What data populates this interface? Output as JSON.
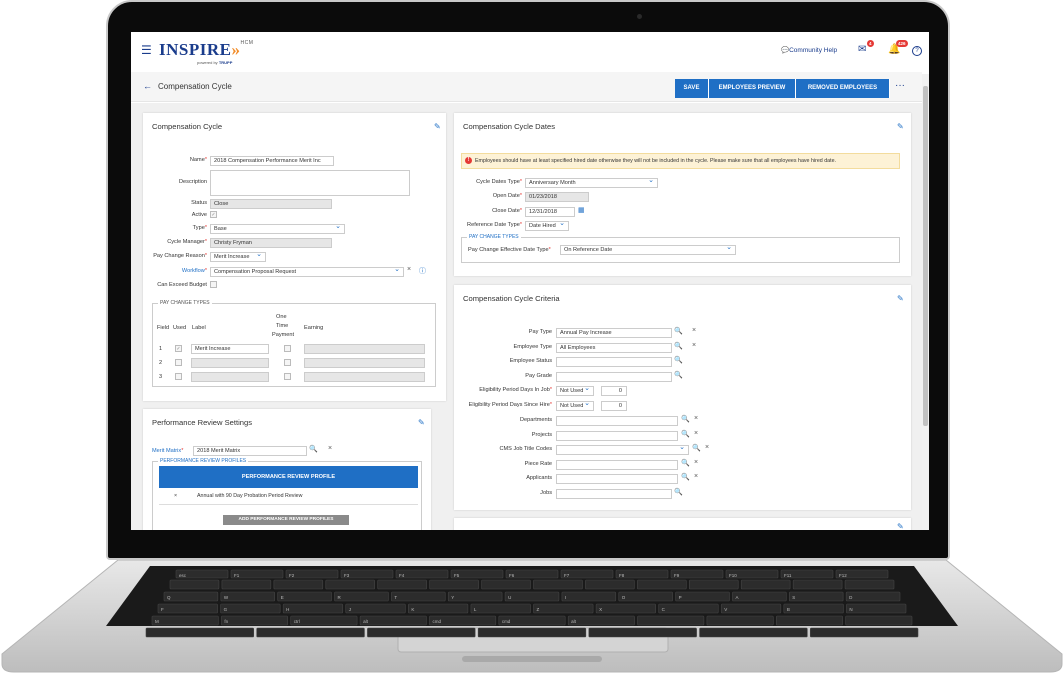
{
  "header": {
    "logo_text": "INSPIRE",
    "logo_arrows": "»",
    "logo_sub": "HCM",
    "tagline_prefix": "powered by",
    "tagline_brand": "TRUPP",
    "community_help": "Community Help",
    "messages_badge": "4",
    "notifications_badge": "426",
    "help_icon": "?"
  },
  "page": {
    "title": "Compensation Cycle",
    "buttons": {
      "save": "SAVE",
      "employees_preview": "EMPLOYEES PREVIEW",
      "removed_employees": "REMOVED EMPLOYEES"
    },
    "more": "···"
  },
  "cycle": {
    "title": "Compensation Cycle",
    "name_label": "Name",
    "name_value": "2018 Compensation Performance Merit Inc",
    "description_label": "Description",
    "status_label": "Status",
    "status_value": "Close",
    "active_label": "Active",
    "type_label": "Type",
    "type_value": "Base",
    "manager_label": "Cycle Manager",
    "manager_value": "Christy Fryman",
    "pay_change_reason_label": "Pay Change Reason",
    "pay_change_reason_value": "Merit Increase",
    "workflow_label": "Workflow",
    "workflow_value": "Compensation Proposal Request",
    "exceed_label": "Can Exceed Budget",
    "pay_change_types": {
      "title": "PAY CHANGE TYPES",
      "col_field": "Field",
      "col_used": "Used",
      "col_label": "Label",
      "col_one1": "One",
      "col_one2": "Time",
      "col_one3": "Payment",
      "col_earning": "Earning",
      "rows": [
        {
          "field": "1",
          "label": "Merit Increase"
        },
        {
          "field": "2",
          "label": ""
        },
        {
          "field": "3",
          "label": ""
        }
      ]
    }
  },
  "perf": {
    "title": "Performance Review Settings",
    "merit_label": "Merit Matrix",
    "merit_value": "2018 Merit Matrix",
    "profiles_title": "PERFORMANCE REVIEW PROFILES",
    "table_header": "PERFORMANCE REVIEW PROFILE",
    "row_value": "Annual with 90 Day Probation Period Review",
    "row_remove": "×",
    "add_button": "ADD PERFORMANCE REVIEW PROFILES"
  },
  "dates": {
    "title": "Compensation Cycle Dates",
    "warning": "Employees should have at least specified hired date otherwise they will not be included in the cycle. Please make sure that all employees have hired date.",
    "warning_icon": "!",
    "cdt_label": "Cycle Dates Type",
    "cdt_value": "Anniversary Month",
    "open_label": "Open Date",
    "open_value": "01/23/2018",
    "close_label": "Close Date",
    "close_value": "12/31/2018",
    "ref_label": "Reference Date Type",
    "ref_value": "Date Hired",
    "pct_title": "PAY CHANGE TYPES",
    "pced_label": "Pay Change Effective Date Type",
    "pced_value": "On Reference Date"
  },
  "criteria": {
    "title": "Compensation Cycle Criteria",
    "pay_type_label": "Pay Type",
    "pay_type_value": "Annual Pay Increase",
    "emp_type_label": "Employee Type",
    "emp_type_value": "All Employees",
    "emp_status_label": "Employee Status",
    "pay_grade_label": "Pay Grade",
    "elig_job_label": "Eligibility Period Days In Job",
    "elig_job_value": "Not Used",
    "elig_job_num": "0",
    "elig_hire_label": "Eligibility Period Days Since Hire",
    "elig_hire_value": "Not Used",
    "elig_hire_num": "0",
    "departments_label": "Departments",
    "projects_label": "Projects",
    "cms_label": "CMS Job Title Codes",
    "piece_label": "Piece Rate",
    "applicants_label": "Applicants",
    "jobs_label": "Jobs"
  },
  "keyboard": {
    "keys": [
      "esc",
      "F1",
      "F2",
      "F3",
      "F4",
      "F5",
      "F6",
      "F7",
      "F8",
      "F9",
      "F10",
      "F11",
      "F12",
      "Q",
      "W",
      "E",
      "R",
      "T",
      "Y",
      "U",
      "I",
      "O",
      "P",
      "A",
      "S",
      "D",
      "F",
      "G",
      "H",
      "J",
      "K",
      "L",
      "Z",
      "X",
      "C",
      "V",
      "B",
      "N",
      "M",
      "fn",
      "ctrl",
      "alt",
      "cmd",
      "cmd",
      "alt"
    ]
  }
}
